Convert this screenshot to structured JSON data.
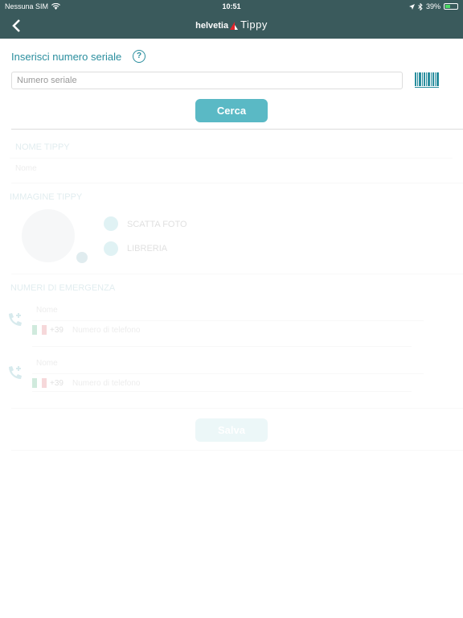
{
  "status_bar": {
    "carrier": "Nessuna SIM",
    "time": "10:51",
    "battery": "39%"
  },
  "nav": {
    "brand_name": "helvetia",
    "app_name": "Tippy"
  },
  "serial": {
    "label": "Inserisci numero seriale",
    "help_glyph": "?",
    "placeholder": "Numero seriale",
    "search_button": "Cerca"
  },
  "name_section": {
    "title": "NOME TIPPY",
    "placeholder": "Nome"
  },
  "image_section": {
    "title": "IMMAGINE TIPPY",
    "take_photo": "SCATTA FOTO",
    "library": "LIBRERIA"
  },
  "emergency_section": {
    "title": "NUMERI DI EMERGENZA",
    "contacts": [
      {
        "name_placeholder": "Nome",
        "prefix": "+39",
        "number_placeholder": "Numero di telefono"
      },
      {
        "name_placeholder": "Nome",
        "prefix": "+39",
        "number_placeholder": "Numero di telefono"
      }
    ]
  },
  "save_button": "Salva",
  "colors": {
    "header": "#3a5a5c",
    "accent": "#2a8e9e",
    "button": "#5ab9c5"
  },
  "icons": [
    "back-chevron-icon",
    "wifi-icon",
    "location-arrow-icon",
    "bluetooth-icon",
    "battery-icon",
    "help-icon",
    "barcode-icon",
    "camera-icon",
    "gallery-icon",
    "add-phone-icon",
    "italy-flag-icon"
  ]
}
